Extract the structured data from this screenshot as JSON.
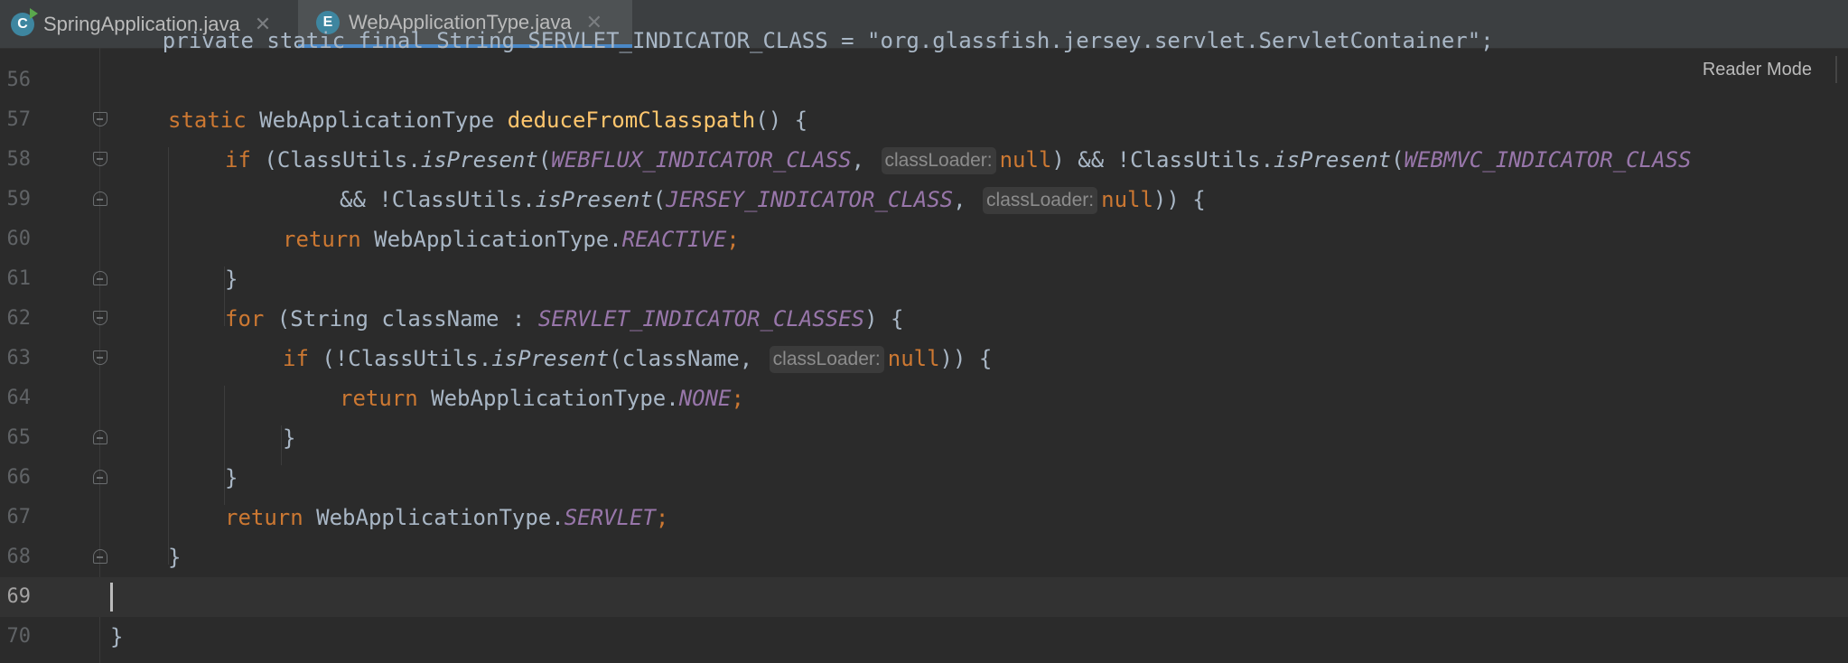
{
  "tabs": [
    {
      "label": "SpringApplication.java",
      "icon": "class-icon",
      "icon_letter": "C",
      "active": false
    },
    {
      "label": "WebApplicationType.java",
      "icon": "enum-icon",
      "icon_letter": "E",
      "active": true
    }
  ],
  "close_glyph": "✕",
  "reader_mode_label": "Reader Mode",
  "editor": {
    "top_partial_line": "    private static final String SERVLET_INDICATOR_CLASS = \"org.glassfish.jersey.servlet.ServletContainer\";",
    "line_numbers": [
      "56",
      "57",
      "58",
      "59",
      "60",
      "61",
      "62",
      "63",
      "64",
      "65",
      "66",
      "67",
      "68",
      "69",
      "70"
    ],
    "hint_label": "classLoader:",
    "tokens": {
      "static": "static",
      "type": "WebApplicationType",
      "method": "deduceFromClasspath",
      "if": "if",
      "for": "for",
      "return": "return",
      "null": "null",
      "class_utils": "ClassUtils",
      "is_present": "isPresent",
      "webflux": "WEBFLUX_INDICATOR_CLASS",
      "webmvc": "WEBMVC_INDICATOR_CLASS",
      "jersey": "JERSEY_INDICATOR_CLASS",
      "servlet_classes": "SERVLET_INDICATOR_CLASSES",
      "string": "String",
      "class_name": "className",
      "reactive": "REACTIVE",
      "none": "NONE",
      "servlet": "SERVLET"
    }
  },
  "colors": {
    "keyword": "#cc7832",
    "method": "#ffc66d",
    "constant": "#9876aa",
    "text": "#a9b7c6",
    "background": "#2b2b2b",
    "tab_underline": "#4a88c7"
  }
}
